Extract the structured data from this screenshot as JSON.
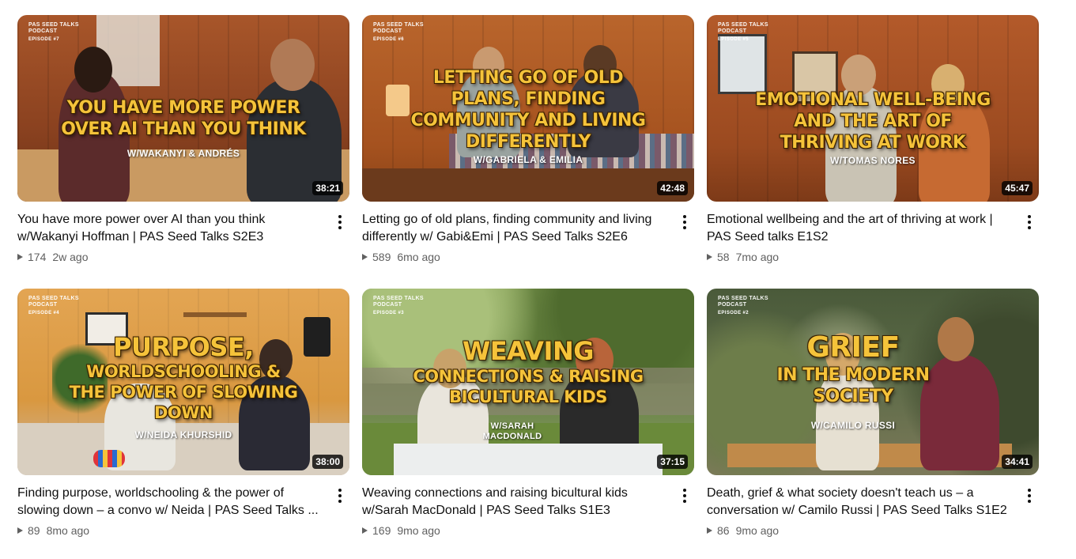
{
  "videos": [
    {
      "title": "You have more power over AI than you think w/Wakanyi Hoffman | PAS Seed Talks S2E3",
      "views": "174",
      "age": "2w ago",
      "duration": "38:21",
      "thumb": {
        "brand": "PAS SEED TALKS PODCAST",
        "episode": "EPISODE #7",
        "overlay": [
          "You have more power",
          "over AI than you think"
        ],
        "guests": "W/WAKANYI & ANDRÉS"
      }
    },
    {
      "title": "Letting go of old plans, finding community and living differently w/ Gabi&Emi | PAS Seed Talks S2E6",
      "views": "589",
      "age": "6mo ago",
      "duration": "42:48",
      "thumb": {
        "brand": "PAS SEED TALKS PODCAST",
        "episode": "EPISODE #6",
        "overlay": [
          "Letting go of old",
          "plans, finding",
          "community and living",
          "differently"
        ],
        "guests": "W/GABRIELA & EMILIA"
      }
    },
    {
      "title": "Emotional wellbeing and the art of thriving at work | PAS Seed talks E1S2",
      "views": "58",
      "age": "7mo ago",
      "duration": "45:47",
      "thumb": {
        "brand": "PAS SEED TALKS PODCAST",
        "episode": "EPISODE #5",
        "overlay": [
          "Emotional well-being",
          "and the art of",
          "thriving at work"
        ],
        "guests": "W/TOMAS NORES"
      }
    },
    {
      "title": "Finding purpose, worldschooling & the power of slowing down – a convo w/ Neida | PAS Seed Talks ...",
      "views": "89",
      "age": "8mo ago",
      "duration": "38:00",
      "thumb": {
        "brand": "PAS SEED TALKS PODCAST",
        "episode": "EPISODE #4",
        "overlay": [
          "Purpose,",
          "worldschooling &",
          "the power of slowing",
          "down"
        ],
        "guests": "W/NEIDA KHURSHID"
      }
    },
    {
      "title": "Weaving connections and raising bicultural kids w/Sarah MacDonald | PAS Seed Talks S1E3",
      "views": "169",
      "age": "9mo ago",
      "duration": "37:15",
      "thumb": {
        "brand": "PAS SEED TALKS PODCAST",
        "episode": "EPISODE #3",
        "overlay": [
          "Weaving",
          "connections & raising",
          "bicultural kids"
        ],
        "guests": "W/SARAH MACDONALD"
      }
    },
    {
      "title": "Death, grief & what society doesn't teach us – a conversation w/ Camilo Russi | PAS Seed Talks S1E2",
      "views": "86",
      "age": "9mo ago",
      "duration": "34:41",
      "thumb": {
        "brand": "PAS SEED TALKS PODCAST",
        "episode": "EPISODE #2",
        "overlay": [
          "Grief",
          "in the modern",
          "society"
        ],
        "guests": "W/CAMILO RUSSI"
      }
    }
  ],
  "icons": {
    "views": "play-triangle-icon",
    "menu": "more-vert-icon"
  },
  "colors": {
    "overlay_text": "#f5c33a",
    "meta_text": "#606060",
    "title_text": "#0f0f0f"
  }
}
